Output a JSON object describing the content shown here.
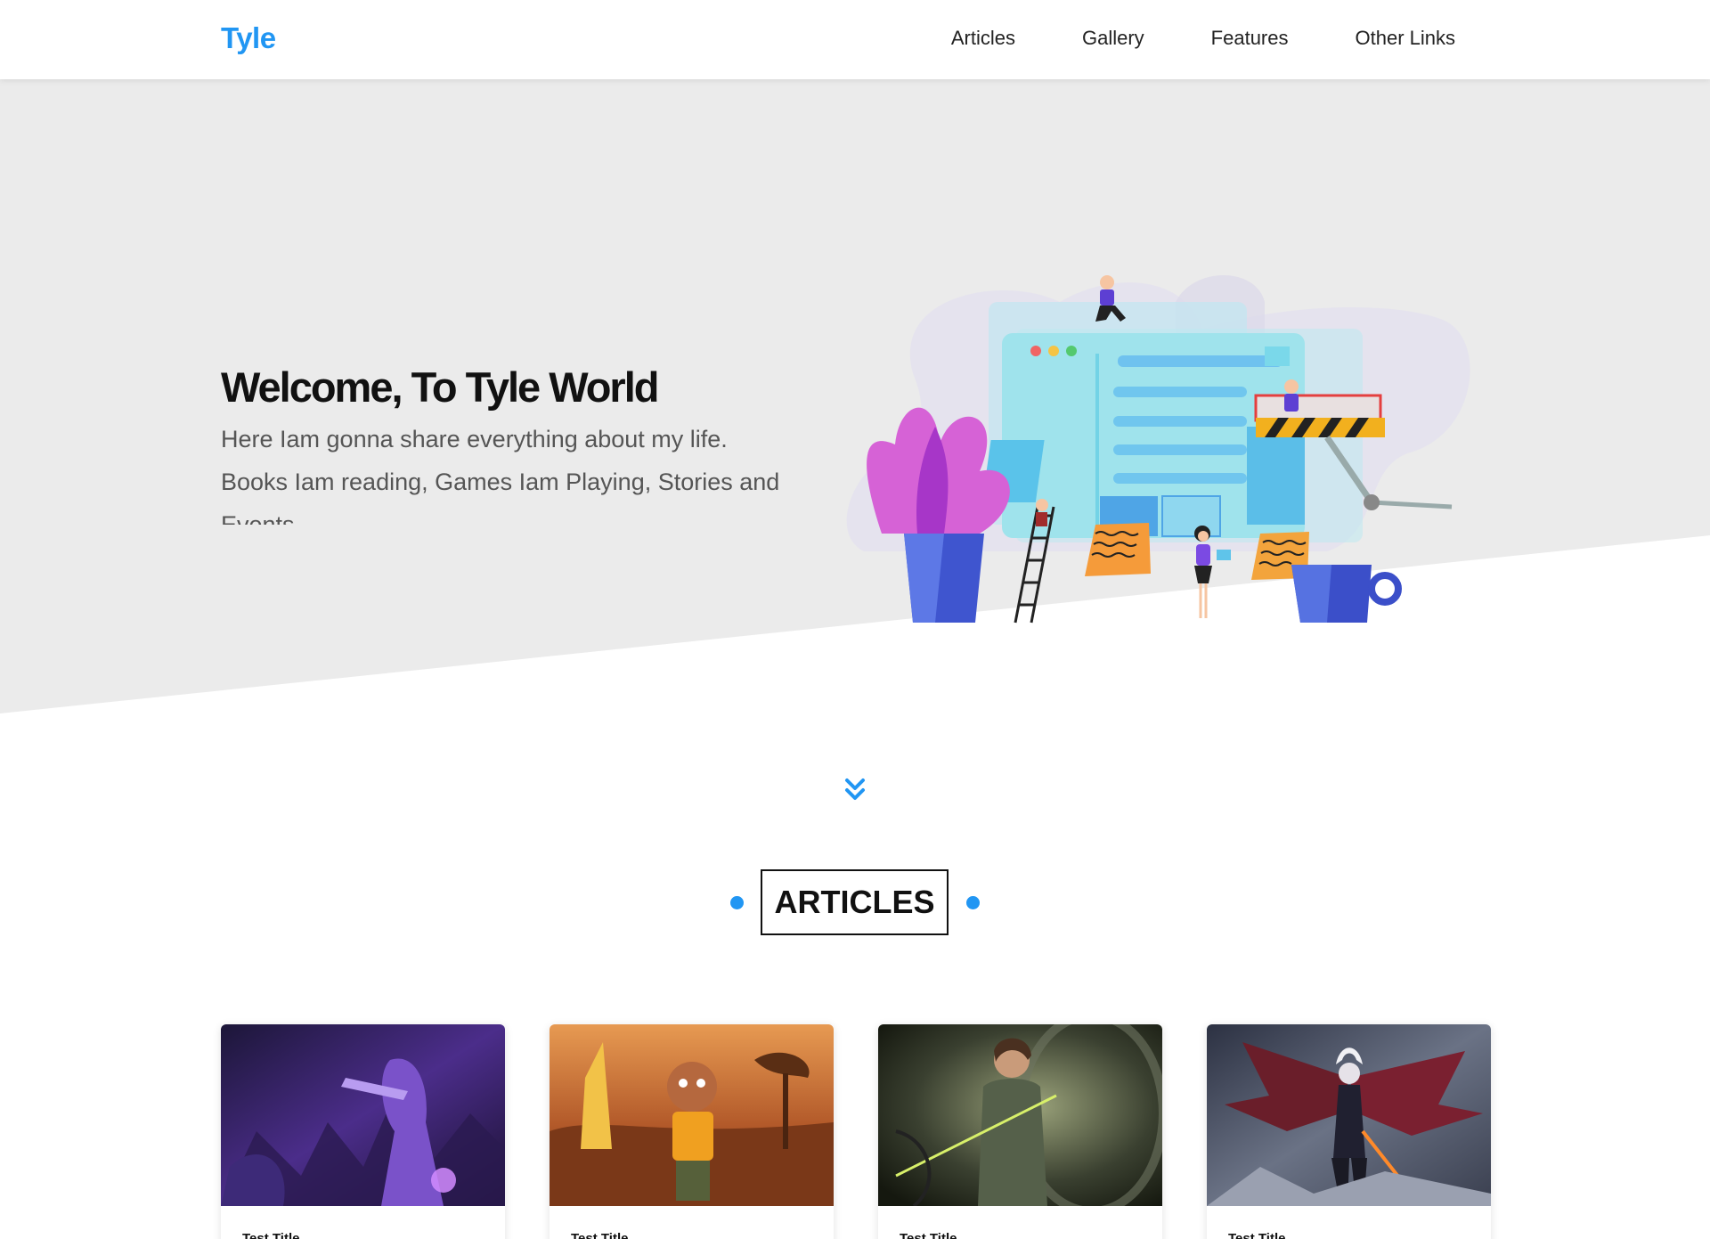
{
  "header": {
    "logo": "Tyle",
    "nav": [
      "Articles",
      "Gallery",
      "Features",
      "Other Links"
    ]
  },
  "hero": {
    "title": "Welcome, To Tyle World",
    "text": "Here Iam gonna share everything about my life. Books Iam reading, Games Iam Playing, Stories and Events"
  },
  "articles": {
    "heading": "ARTICLES",
    "cards": [
      {
        "title": "Test Title",
        "image": "purple-armored-warrior-artwork"
      },
      {
        "title": "Test Title",
        "image": "orange-savanna-character-artwork"
      },
      {
        "title": "Test Title",
        "image": "archer-woman-forest-artwork"
      },
      {
        "title": "Test Title",
        "image": "winged-demon-warrior-artwork"
      }
    ]
  },
  "colors": {
    "accent": "#2196f3",
    "hero_bg": "#ebebeb",
    "text_dark": "#111111",
    "text_muted": "#555555"
  }
}
